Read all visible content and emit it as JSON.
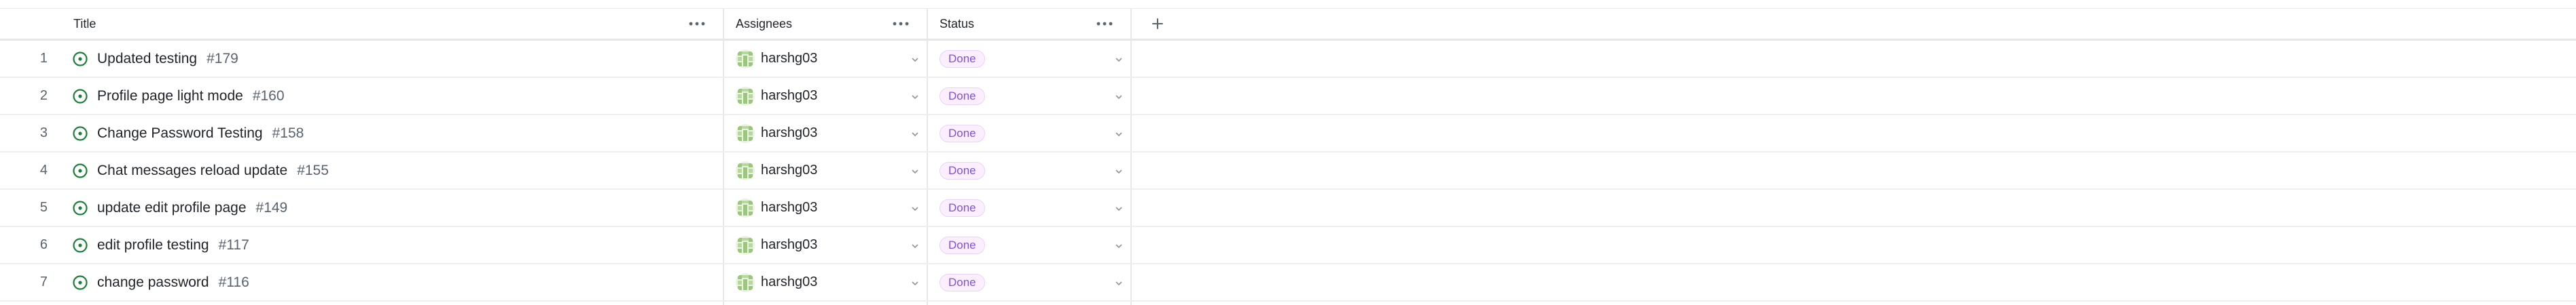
{
  "columns": {
    "title": "Title",
    "assignees": "Assignees",
    "status": "Status",
    "more_icon": "more-horizontal-icon",
    "add_icon": "plus-icon"
  },
  "colors": {
    "issue_closed_green": "#1a7f37",
    "status_done_text": "#8250df",
    "status_done_bg": "#fbefff"
  },
  "rows": [
    {
      "index": "1",
      "title": "Updated testing",
      "issue": "#179",
      "assignee": "harshg03",
      "status": "Done"
    },
    {
      "index": "2",
      "title": "Profile page light mode",
      "issue": "#160",
      "assignee": "harshg03",
      "status": "Done"
    },
    {
      "index": "3",
      "title": "Change Password Testing",
      "issue": "#158",
      "assignee": "harshg03",
      "status": "Done"
    },
    {
      "index": "4",
      "title": "Chat messages reload update",
      "issue": "#155",
      "assignee": "harshg03",
      "status": "Done"
    },
    {
      "index": "5",
      "title": "update edit profile page",
      "issue": "#149",
      "assignee": "harshg03",
      "status": "Done"
    },
    {
      "index": "6",
      "title": "edit profile testing",
      "issue": "#117",
      "assignee": "harshg03",
      "status": "Done"
    },
    {
      "index": "7",
      "title": "change password",
      "issue": "#116",
      "assignee": "harshg03",
      "status": "Done"
    }
  ]
}
